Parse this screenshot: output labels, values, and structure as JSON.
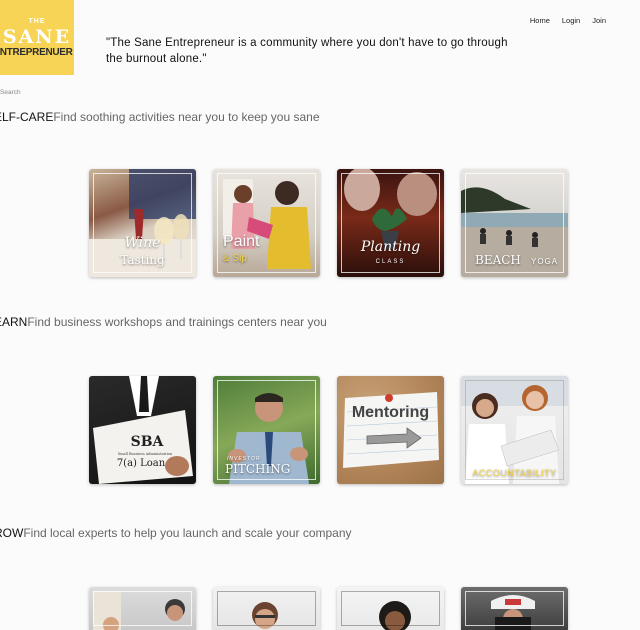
{
  "logo": {
    "line1": "THE",
    "line2": "SANE",
    "line3": "ENTREPRENUER"
  },
  "tagline": "\"The Sane Entrepreneur is a community where you don't have to go through the burnout alone.\"",
  "nav": {
    "home": "Home",
    "login": "Login",
    "join": "Join"
  },
  "search": {
    "placeholder": "Search"
  },
  "sections": [
    {
      "title": "ELF-CARE",
      "description": "Find soothing activities near you to keep you sane",
      "cards": [
        {
          "caption": "Wine",
          "caption2": "Tasting"
        },
        {
          "caption": "Paint",
          "caption2": "& Sip"
        },
        {
          "caption": "Planting",
          "caption2": "CLASS"
        },
        {
          "caption": "BEACH",
          "caption2": "YOGA"
        }
      ]
    },
    {
      "title": "EARN",
      "description": "Find business workshops and trainings centers near you",
      "cards": [
        {
          "caption": "SBA",
          "caption2": "Small Business Administration",
          "caption3": "7(a) Loan"
        },
        {
          "caption": "INVESTOR",
          "caption2": "PITCHING"
        },
        {
          "caption": "Mentoring"
        },
        {
          "caption": "ACCOUNTABILITY"
        }
      ]
    },
    {
      "title": "ROW",
      "description": "Find local experts to help you launch and scale your company",
      "cards": [
        {},
        {},
        {},
        {}
      ]
    }
  ],
  "colors": {
    "logo_bg": "#f7d455",
    "accountability": "#f3d34a"
  }
}
